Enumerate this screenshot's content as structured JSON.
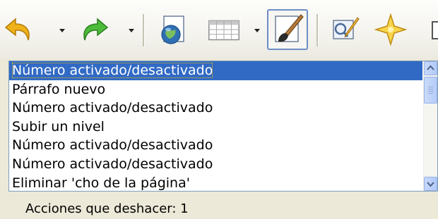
{
  "toolbar": {
    "buttons": [
      {
        "name": "undo",
        "icon": "undo-arrow-icon",
        "has_dropdown": true
      },
      {
        "name": "redo",
        "icon": "redo-arrow-icon",
        "has_dropdown": true
      },
      {
        "name": "navigator",
        "icon": "globe-document-icon",
        "has_dropdown": false
      },
      {
        "name": "table",
        "icon": "table-icon",
        "has_dropdown": true
      },
      {
        "name": "format-paintbrush",
        "icon": "paintbrush-icon",
        "has_dropdown": false,
        "active": true
      },
      {
        "name": "edit-document",
        "icon": "edit-pencil-icon",
        "has_dropdown": false
      },
      {
        "name": "navigator-star",
        "icon": "star-compass-icon",
        "has_dropdown": false
      }
    ]
  },
  "undo_list": {
    "items": [
      "Número activado/desactivado",
      "Párrafo nuevo",
      "Número activado/desactivado",
      "Subir un nivel",
      "Número activado/desactivado",
      "Número activado/desactivado",
      "Eliminar 'cho de la página'"
    ],
    "selected_index": 0
  },
  "status": {
    "text": "Acciones que deshacer: 1"
  },
  "colors": {
    "selection": "#316ac5",
    "toolbar_bg": "#f4f3ee",
    "panel_bg": "#ece9d8"
  }
}
